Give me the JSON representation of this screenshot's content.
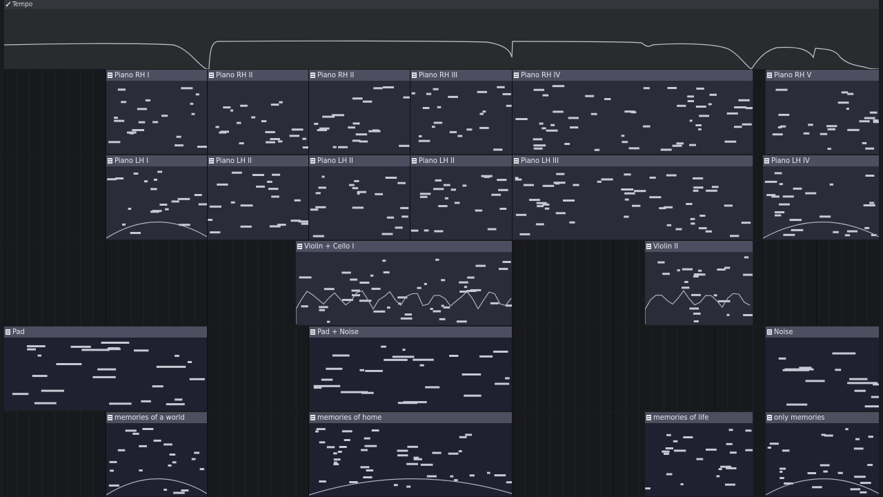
{
  "tempo": {
    "label": "Tempo",
    "icon": "tempo-automation-icon"
  },
  "lanes": [
    {
      "id": "piano-rh",
      "clips": [
        {
          "label": "Piano RH I",
          "start": 148,
          "width": 146
        },
        {
          "label": "Piano RH II",
          "start": 295,
          "width": 146
        },
        {
          "label": "Piano RH II",
          "start": 442,
          "width": 146
        },
        {
          "label": "Piano RH III",
          "start": 589,
          "width": 147
        },
        {
          "label": "Piano RH IV",
          "start": 737,
          "width": 348
        },
        {
          "label": "Piano RH V",
          "start": 1104,
          "width": 164
        }
      ]
    },
    {
      "id": "piano-lh",
      "clips": [
        {
          "label": "Piano LH I",
          "start": 148,
          "width": 146
        },
        {
          "label": "Piano LH II",
          "start": 295,
          "width": 146
        },
        {
          "label": "Piano LH II",
          "start": 442,
          "width": 146
        },
        {
          "label": "Piano LH II",
          "start": 589,
          "width": 147
        },
        {
          "label": "Piano LH III",
          "start": 737,
          "width": 348
        },
        {
          "label": "Piano LH IV",
          "start": 1100,
          "width": 168
        }
      ]
    },
    {
      "id": "strings",
      "clips": [
        {
          "label": "Violin + Cello I",
          "start": 423,
          "width": 313
        },
        {
          "label": "Violin II",
          "start": 929,
          "width": 156
        }
      ]
    },
    {
      "id": "pad",
      "clips": [
        {
          "label": "Pad",
          "start": 0,
          "width": 294
        },
        {
          "label": "Pad + Noise",
          "start": 442,
          "width": 294
        },
        {
          "label": "Noise",
          "start": 1104,
          "width": 164
        }
      ]
    },
    {
      "id": "memories",
      "clips": [
        {
          "label": "memories of a world",
          "start": 148,
          "width": 146
        },
        {
          "label": "memories of home",
          "start": 442,
          "width": 294
        },
        {
          "label": "memories of life",
          "start": 929,
          "width": 156
        },
        {
          "label": "only memories",
          "start": 1104,
          "width": 164
        }
      ]
    }
  ],
  "colors": {
    "background": "#18191c",
    "tempo_bg": "#2a2b2f",
    "clip_header": "#4d4f60",
    "clip_body": "#2b2c3a",
    "note": "#c8c9d4",
    "automation_line": "#b0b2c0"
  }
}
